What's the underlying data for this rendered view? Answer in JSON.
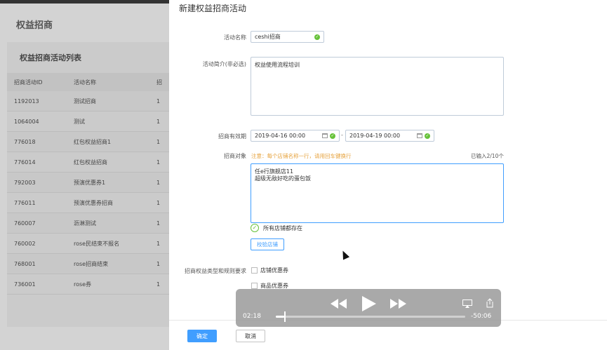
{
  "bg": {
    "title": "权益招商",
    "card_title": "权益招商活动列表",
    "headers": [
      "招商活动ID",
      "活动名称",
      "招"
    ],
    "rows": [
      {
        "id": "1192013",
        "name": "测试招商",
        "c": "1"
      },
      {
        "id": "1064004",
        "name": "测试",
        "c": "1"
      },
      {
        "id": "776018",
        "name": "红包权益招商1",
        "c": "1"
      },
      {
        "id": "776014",
        "name": "红包权益招商",
        "c": "1"
      },
      {
        "id": "792003",
        "name": "预演优惠券1",
        "c": "1"
      },
      {
        "id": "776011",
        "name": "预演优惠券招商",
        "c": "1"
      },
      {
        "id": "760007",
        "name": "沥淋测试",
        "c": "1"
      },
      {
        "id": "760002",
        "name": "rose民结束不报名",
        "c": "1"
      },
      {
        "id": "768001",
        "name": "rose招商结束",
        "c": "1"
      },
      {
        "id": "736001",
        "name": "rose券",
        "c": "1"
      }
    ]
  },
  "drawer": {
    "title": "新建权益招商活动",
    "name_label": "活动名称",
    "name_value": "ceshi招商",
    "intro_label": "活动简介(非必选)",
    "intro_value": "权益使用流程培训",
    "period_label": "招商有效期",
    "start_date": "2019-04-16 00:00",
    "end_date": "2019-04-19 00:00",
    "date_sep": "-",
    "target_label": "招商对象",
    "target_note": "注意：每个店铺名称一行，请用回车键换行",
    "target_count": "已输入2/10个",
    "target_value": "任e行旗舰店11\n超级无敌好吃的蛋包饭",
    "ok_text": "所有店铺都存在",
    "verify_button": "校验店铺",
    "rules_label": "招商权益类型和规则要求",
    "options": [
      "店铺优惠券",
      "商品优惠券"
    ],
    "confirm_button": "确定",
    "cancel_button": "取消"
  },
  "player": {
    "elapsed": "02:18",
    "remaining": "-50:06",
    "progress": 0.043
  }
}
